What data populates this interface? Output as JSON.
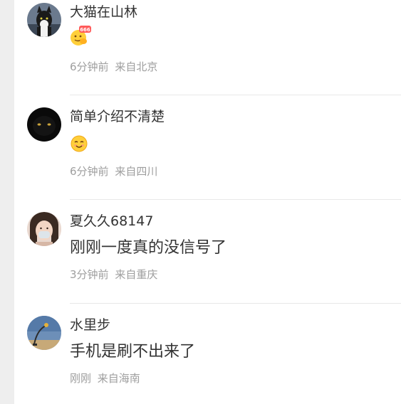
{
  "comments": [
    {
      "username": "大猫在山林",
      "content_icon": "666-emoji-icon",
      "emoji_badge": "666",
      "time": "6分钟前",
      "location": "来自北京"
    },
    {
      "username": "简单介绍不清楚",
      "content_icon": "smile-emoji-icon",
      "time": "6分钟前",
      "location": "来自四川"
    },
    {
      "username": "夏久久68147",
      "content": "刚刚一度真的没信号了",
      "time": "3分钟前",
      "location": "来自重庆"
    },
    {
      "username": "水里步",
      "content": "手机是刷不出来了",
      "time": "刚刚",
      "location": "来自海南"
    }
  ]
}
